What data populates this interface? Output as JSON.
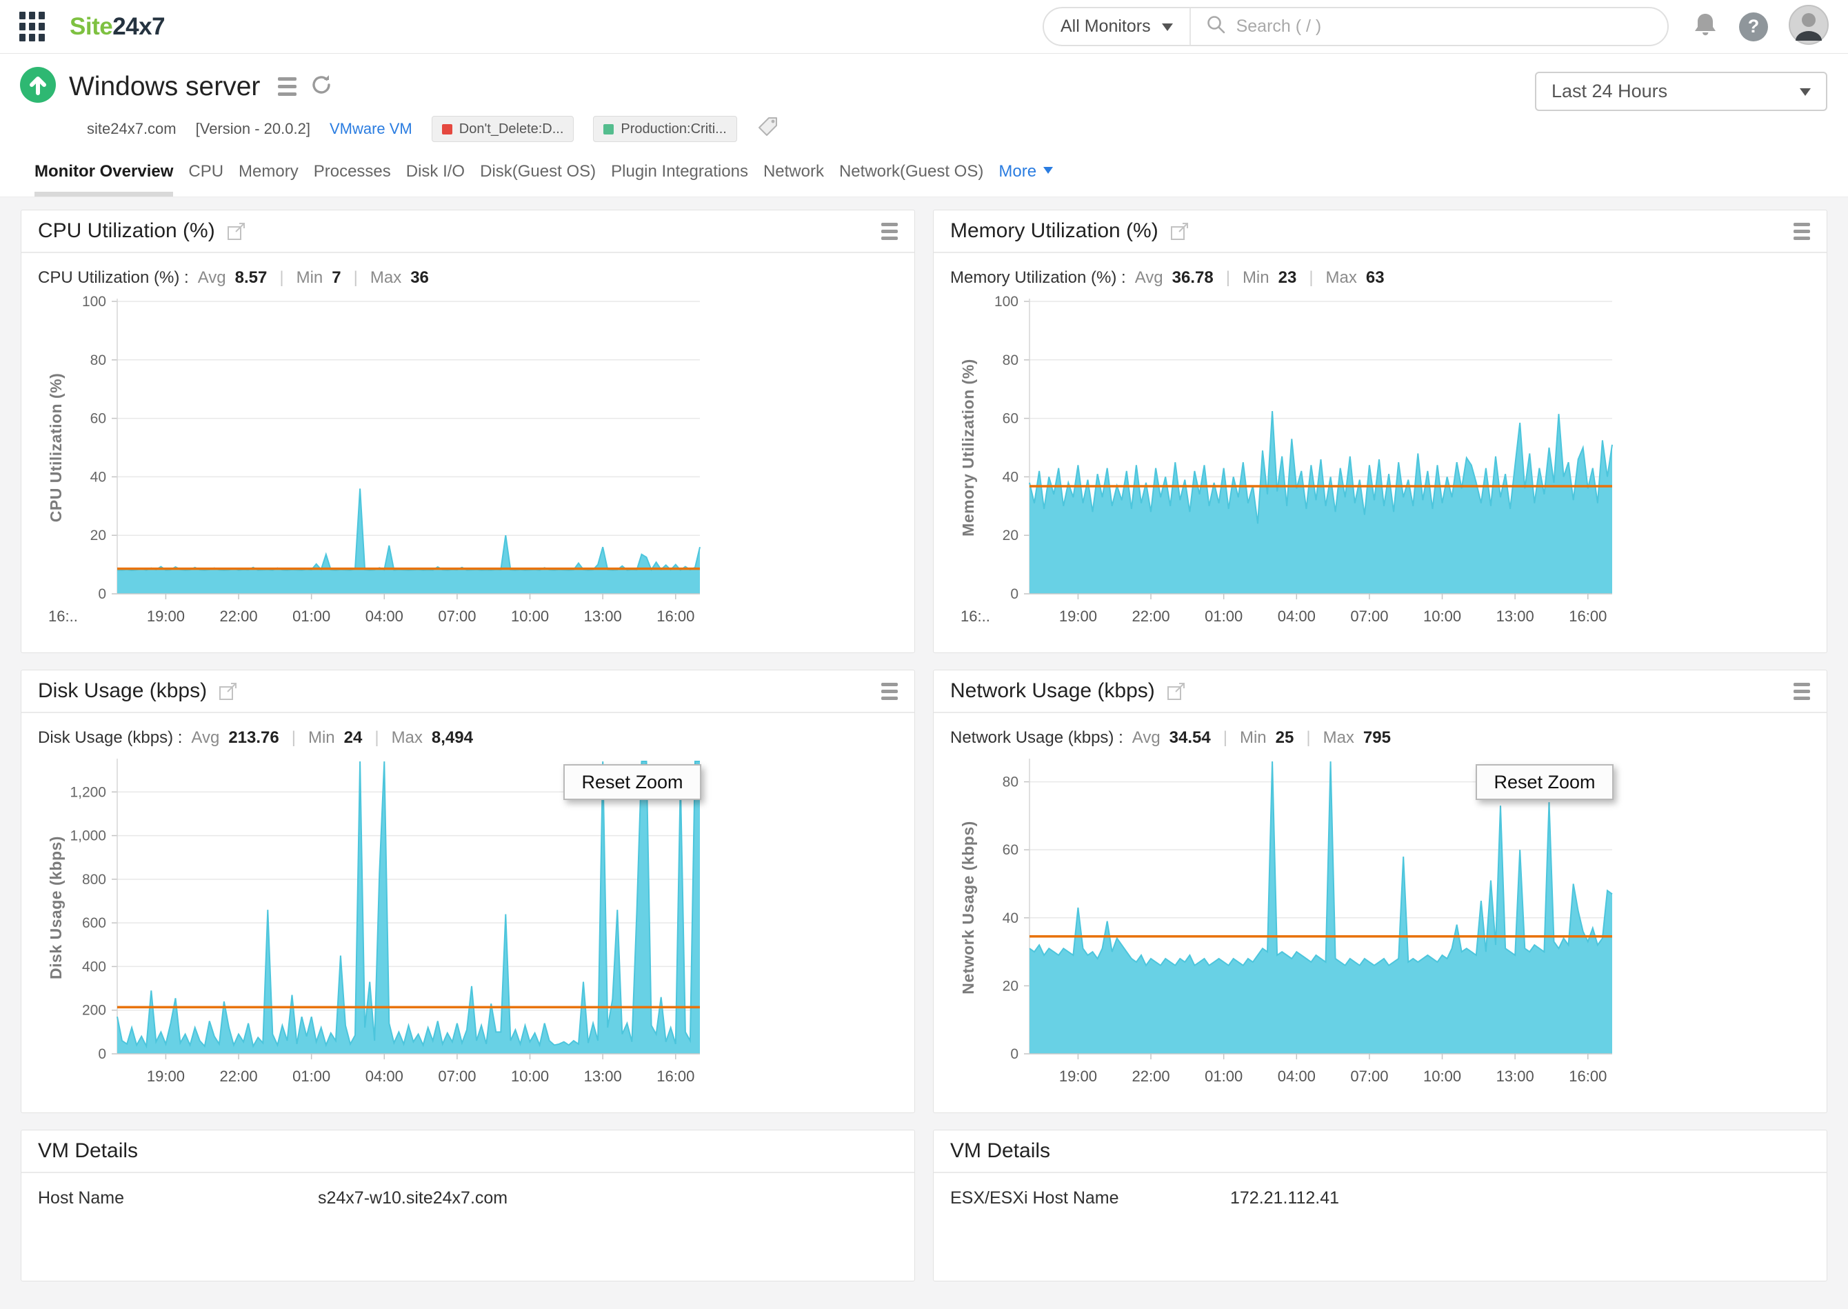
{
  "ui": {
    "pipe": "|",
    "help_glyph": "?"
  },
  "colors": {
    "brand_green": "#7ec141",
    "brand_dark": "#253340",
    "status_up_green": "#2eb872",
    "link_blue": "#2a7ce0",
    "threshold_orange": "#e8730b",
    "area_fill": "#68d1e5",
    "tag_red": "#e5483f",
    "tag_green": "#54bd8e",
    "active_tab_underline": "#d9d9d9"
  },
  "header": {
    "logo_part1": "Site",
    "logo_part2": "24x7",
    "monitor_scope": "All Monitors",
    "search_placeholder": "Search ( / )"
  },
  "monitor": {
    "title": "Windows server",
    "host": "site24x7.com",
    "version": "[Version - 20.0.2]",
    "type_link": "VMware VM",
    "tags": [
      {
        "label": "Don't_Delete:D...",
        "color": "#e5483f"
      },
      {
        "label": "Production:Criti...",
        "color": "#54bd8e"
      }
    ],
    "time_range": "Last 24 Hours"
  },
  "tabs": {
    "items": [
      {
        "label": "Monitor Overview",
        "active": true
      },
      {
        "label": "CPU"
      },
      {
        "label": "Memory"
      },
      {
        "label": "Processes"
      },
      {
        "label": "Disk I/O"
      },
      {
        "label": "Disk(Guest OS)"
      },
      {
        "label": "Plugin Integrations"
      },
      {
        "label": "Network"
      },
      {
        "label": "Network(Guest OS)"
      },
      {
        "label": "More",
        "more": true
      }
    ]
  },
  "panels": [
    {
      "title": "CPU Utilization (%)",
      "stats": {
        "label": "CPU Utilization (%) :",
        "avg_label": "Avg",
        "avg": "8.57",
        "min_label": "Min",
        "min": "7",
        "max_label": "Max",
        "max": "36"
      }
    },
    {
      "title": "Memory Utilization (%)",
      "stats": {
        "label": "Memory Utilization (%) :",
        "avg_label": "Avg",
        "avg": "36.78",
        "min_label": "Min",
        "min": "23",
        "max_label": "Max",
        "max": "63"
      }
    },
    {
      "title": "Disk Usage (kbps)",
      "reset_zoom_label": "Reset Zoom",
      "stats": {
        "label": "Disk Usage (kbps) :",
        "avg_label": "Avg",
        "avg": "213.76",
        "min_label": "Min",
        "min": "24",
        "max_label": "Max",
        "max": "8,494"
      }
    },
    {
      "title": "Network Usage (kbps)",
      "reset_zoom_label": "Reset Zoom",
      "stats": {
        "label": "Network Usage (kbps) :",
        "avg_label": "Avg",
        "avg": "34.54",
        "min_label": "Min",
        "min": "25",
        "max_label": "Max",
        "max": "795"
      }
    }
  ],
  "vm_details_left": {
    "title": "VM Details",
    "rows": [
      {
        "label": "Host Name",
        "value": "s24x7-w10.site24x7.com"
      }
    ]
  },
  "vm_details_right": {
    "title": "VM Details",
    "rows": [
      {
        "label": "ESX/ESXi Host Name",
        "value": "172.21.112.41"
      }
    ]
  },
  "chart_data": [
    {
      "type": "area",
      "title": "CPU Utilization (%)",
      "ylabel": "CPU Utilization (%)",
      "ylim": [
        0,
        100
      ],
      "yticks": [
        0,
        20,
        40,
        60,
        80,
        100
      ],
      "ytick_labels": [
        "0",
        "20",
        "40",
        "60",
        "80",
        "100"
      ],
      "x_start_hour": 17,
      "x_step_hours": 0.2,
      "xticks": [
        19,
        22,
        25,
        28,
        31,
        34,
        37,
        40
      ],
      "xtick_labels": [
        "19:00",
        "22:00",
        "01:00",
        "04:00",
        "07:00",
        "10:00",
        "13:00",
        "16:00"
      ],
      "x_edge_label": "16:..",
      "threshold": 8.57,
      "grid": true,
      "legend": "none",
      "area_color": "#68d1e5",
      "line_color": "#4cc5dc",
      "threshold_color": "#e8730b",
      "values": [
        8.2,
        8.1,
        8.3,
        8.0,
        8.2,
        8.6,
        8.1,
        8.8,
        8.2,
        9.3,
        8.1,
        8.2,
        9.2,
        8.3,
        8.1,
        8.2,
        9.0,
        8.2,
        8.1,
        8.3,
        8.8,
        8.2,
        8.1,
        8.2,
        8.7,
        8.1,
        8.3,
        8.2,
        9.0,
        8.1,
        8.2,
        8.3,
        8.1,
        8.8,
        8.2,
        8.1,
        8.3,
        8.2,
        8.1,
        8.4,
        8.2,
        10.2,
        8.3,
        13.5,
        8.2,
        8.1,
        8.3,
        8.2,
        8.1,
        8.5,
        36.0,
        8.3,
        8.1,
        8.2,
        8.9,
        8.2,
        16.5,
        8.1,
        8.3,
        8.2,
        8.1,
        8.2,
        8.3,
        8.1,
        8.2,
        8.1,
        9.2,
        8.2,
        8.1,
        8.3,
        8.2,
        9.0,
        8.1,
        8.2,
        8.3,
        8.1,
        8.2,
        8.1,
        8.3,
        8.2,
        20.0,
        8.2,
        8.1,
        8.3,
        8.1,
        8.2,
        8.3,
        8.1,
        8.9,
        8.2,
        8.1,
        8.3,
        8.2,
        8.1,
        8.2,
        10.5,
        8.3,
        8.1,
        8.2,
        10.0,
        16.0,
        8.3,
        8.1,
        8.2,
        9.5,
        8.1,
        8.3,
        8.2,
        13.5,
        12.5,
        8.2,
        10.8,
        8.3,
        9.8,
        8.2,
        10.0,
        8.1,
        9.3,
        8.2,
        9.0,
        16.0
      ]
    },
    {
      "type": "area",
      "title": "Memory Utilization (%)",
      "ylabel": "Memory Utilization (%)",
      "ylim": [
        0,
        100
      ],
      "yticks": [
        0,
        20,
        40,
        60,
        80,
        100
      ],
      "ytick_labels": [
        "0",
        "20",
        "40",
        "60",
        "80",
        "100"
      ],
      "x_start_hour": 17,
      "x_step_hours": 0.2,
      "xticks": [
        19,
        22,
        25,
        28,
        31,
        34,
        37,
        40
      ],
      "xtick_labels": [
        "19:00",
        "22:00",
        "01:00",
        "04:00",
        "07:00",
        "10:00",
        "13:00",
        "16:00"
      ],
      "x_edge_label": "16:..",
      "threshold": 36.78,
      "grid": true,
      "legend": "none",
      "area_color": "#68d1e5",
      "line_color": "#4cc5dc",
      "threshold_color": "#e8730b",
      "values": [
        38,
        31,
        42,
        29,
        40,
        34,
        43,
        30,
        38,
        33,
        44,
        31,
        39,
        28,
        41,
        33,
        43,
        30,
        37,
        32,
        42,
        29,
        44,
        31,
        38,
        28,
        43,
        33,
        40,
        30,
        45,
        32,
        39,
        28,
        42,
        34,
        44,
        30,
        38,
        31,
        43,
        29,
        40,
        33,
        45,
        31,
        37,
        24,
        49,
        34,
        62.5,
        35,
        47,
        30,
        53,
        36,
        42,
        29,
        44,
        32,
        46,
        30,
        40,
        28,
        43,
        33,
        47,
        31,
        39,
        27,
        44,
        32,
        46,
        30,
        41,
        28,
        45,
        33,
        39,
        30,
        48,
        32,
        42,
        29,
        44,
        31,
        40,
        33,
        45,
        36,
        46.5,
        44,
        38,
        31,
        43,
        30,
        47,
        33,
        41,
        29,
        44,
        58.5,
        36,
        48,
        31,
        43,
        34,
        50,
        38,
        61.5,
        40,
        45,
        32,
        46,
        50,
        36,
        43,
        31,
        52.5,
        40,
        51
      ]
    },
    {
      "type": "area",
      "title": "Disk Usage (kbps)",
      "ylabel": "Disk Usage (kbps)",
      "ylim": [
        0,
        1340
      ],
      "yticks": [
        0,
        200,
        400,
        600,
        800,
        1000,
        1200
      ],
      "ytick_labels": [
        "0",
        "200",
        "400",
        "600",
        "800",
        "1,000",
        "1,200"
      ],
      "x_start_hour": 17,
      "x_step_hours": 0.2,
      "xticks": [
        19,
        22,
        25,
        28,
        31,
        34,
        37,
        40
      ],
      "xtick_labels": [
        "19:00",
        "22:00",
        "01:00",
        "04:00",
        "07:00",
        "10:00",
        "13:00",
        "16:00"
      ],
      "threshold": 213.76,
      "grid": true,
      "legend": "none",
      "zoomed": true,
      "area_color": "#68d1e5",
      "line_color": "#4cc5dc",
      "threshold_color": "#e8730b",
      "values": [
        170,
        60,
        45,
        120,
        40,
        80,
        35,
        290,
        55,
        100,
        45,
        140,
        255,
        50,
        90,
        40,
        120,
        60,
        35,
        150,
        80,
        45,
        240,
        120,
        40,
        90,
        55,
        140,
        35,
        75,
        50,
        660,
        90,
        40,
        130,
        60,
        270,
        45,
        170,
        80,
        170,
        55,
        120,
        40,
        95,
        60,
        450,
        130,
        45,
        85,
        8494,
        120,
        330,
        60,
        830,
        8200,
        140,
        50,
        100,
        45,
        130,
        55,
        90,
        40,
        120,
        60,
        150,
        45,
        95,
        55,
        140,
        50,
        110,
        310,
        60,
        130,
        45,
        230,
        100,
        100,
        640,
        60,
        110,
        45,
        130,
        55,
        95,
        40,
        140,
        60,
        40,
        45,
        55,
        40,
        60,
        45,
        330,
        50,
        140,
        60,
        7000,
        120,
        250,
        660,
        90,
        140,
        55,
        650,
        7500,
        6000,
        130,
        90,
        260,
        55,
        120,
        45,
        1250,
        100,
        60,
        8200,
        8494
      ]
    },
    {
      "type": "area",
      "title": "Network Usage (kbps)",
      "ylabel": "Network Usage (kbps)",
      "ylim": [
        0,
        86
      ],
      "yticks": [
        0,
        20,
        40,
        60,
        80
      ],
      "ytick_labels": [
        "0",
        "20",
        "40",
        "60",
        "80"
      ],
      "x_start_hour": 17,
      "x_step_hours": 0.2,
      "xticks": [
        19,
        22,
        25,
        28,
        31,
        34,
        37,
        40
      ],
      "xtick_labels": [
        "19:00",
        "22:00",
        "01:00",
        "04:00",
        "07:00",
        "10:00",
        "13:00",
        "16:00"
      ],
      "threshold": 34.54,
      "grid": true,
      "legend": "none",
      "zoomed": true,
      "area_color": "#68d1e5",
      "line_color": "#4cc5dc",
      "threshold_color": "#e8730b",
      "values": [
        31,
        30,
        32,
        29,
        31,
        30,
        29,
        31,
        30,
        29,
        43,
        31,
        29,
        30,
        28,
        31,
        39,
        30,
        34,
        32,
        30,
        28,
        27,
        29,
        26,
        28,
        27,
        26,
        28,
        27,
        26,
        28,
        27,
        29,
        26,
        27,
        28,
        26,
        27,
        28,
        27,
        26,
        28,
        27,
        26,
        28,
        27,
        29,
        31,
        30,
        795,
        29,
        30,
        29,
        28,
        30,
        29,
        28,
        27,
        29,
        28,
        27,
        500,
        28,
        27,
        26,
        28,
        27,
        26,
        28,
        27,
        26,
        27,
        28,
        26,
        27,
        28,
        58,
        27,
        28,
        27,
        28,
        29,
        28,
        27,
        29,
        28,
        31,
        38,
        30,
        31,
        30,
        29,
        45,
        30,
        51,
        32,
        73,
        31,
        30,
        29,
        60,
        31,
        30,
        32,
        31,
        30,
        74,
        33,
        31,
        34,
        32,
        50,
        42,
        36,
        33,
        37,
        32,
        34,
        48,
        47
      ]
    }
  ]
}
